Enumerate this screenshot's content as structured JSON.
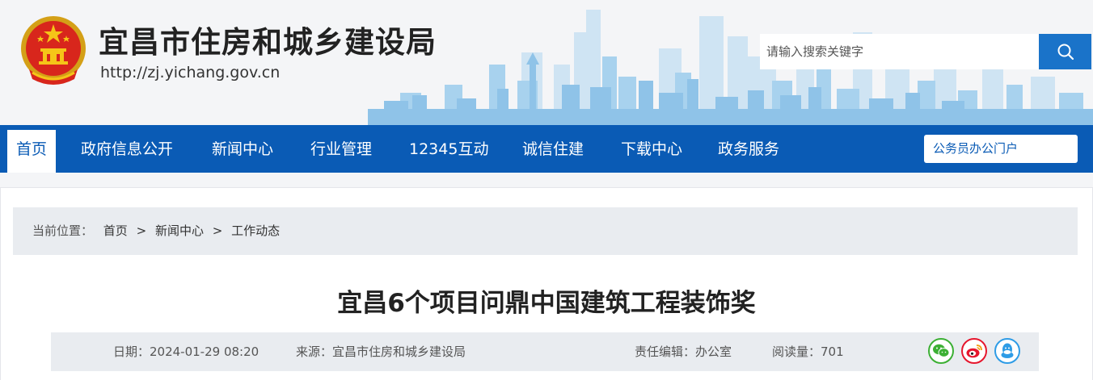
{
  "header": {
    "site_title": "宜昌市住房和城乡建设局",
    "site_url": "http://zj.yichang.gov.cn",
    "search_placeholder": "请输入搜索关键字"
  },
  "nav": {
    "items": [
      "首页",
      "政府信息公开",
      "新闻中心",
      "行业管理",
      "12345互动",
      "诚信住建",
      "下载中心",
      "政务服务"
    ],
    "active_index": 0,
    "portal_label": "公务员办公门户"
  },
  "breadcrumb": {
    "prefix": "当前位置：",
    "items": [
      "首页",
      "新闻中心",
      "工作动态"
    ],
    "separator": ">"
  },
  "article": {
    "title": "宜昌6个项目问鼎中国建筑工程装饰奖",
    "date": "日期：2024-01-29 08:20",
    "source": "来源：宜昌市住房和城乡建设局",
    "editor": "责任编辑：办公室",
    "views": "阅读量：701"
  },
  "share": {
    "icons": [
      "wechat-icon",
      "weibo-icon",
      "qq-icon"
    ]
  },
  "colors": {
    "nav_bg": "#0a5bb5",
    "search_btn": "#1a73c9",
    "skyline": "#8fc3e8",
    "wechat": "#3cb034",
    "weibo": "#e6162d",
    "qq": "#2e9ce6"
  }
}
